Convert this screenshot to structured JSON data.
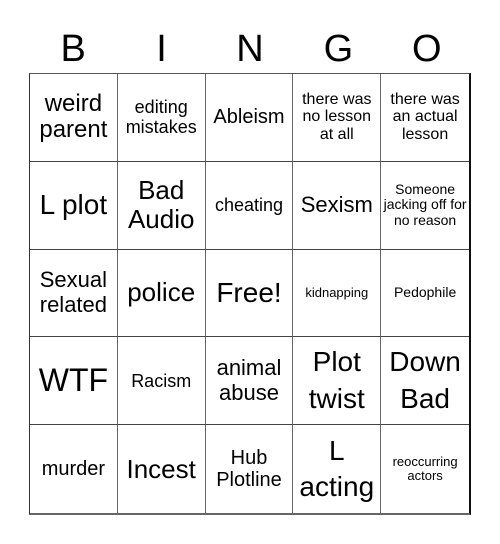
{
  "header": {
    "letters": [
      "B",
      "I",
      "N",
      "G",
      "O"
    ]
  },
  "cells": [
    {
      "text": "weird parent"
    },
    {
      "text": "editing mistakes"
    },
    {
      "text": "Ableism"
    },
    {
      "text": "there was no lesson at all"
    },
    {
      "text": "there was an actual lesson"
    },
    {
      "text": "L plot"
    },
    {
      "text": "Bad Audio"
    },
    {
      "text": "cheating"
    },
    {
      "text": "Sexism"
    },
    {
      "text": "Someone jacking off for no reason"
    },
    {
      "text": "Sexual related"
    },
    {
      "text": "police"
    },
    {
      "text": "Free!"
    },
    {
      "text": "kidnapping"
    },
    {
      "text": "Pedophile"
    },
    {
      "text": "WTF"
    },
    {
      "text": "Racism"
    },
    {
      "text": "animal abuse"
    },
    {
      "text": "Plot twist"
    },
    {
      "text": "Down Bad"
    },
    {
      "text": "murder"
    },
    {
      "text": "Incest"
    },
    {
      "text": "Hub Plotline"
    },
    {
      "text": "L acting"
    },
    {
      "text": "reoccurring actors"
    }
  ]
}
